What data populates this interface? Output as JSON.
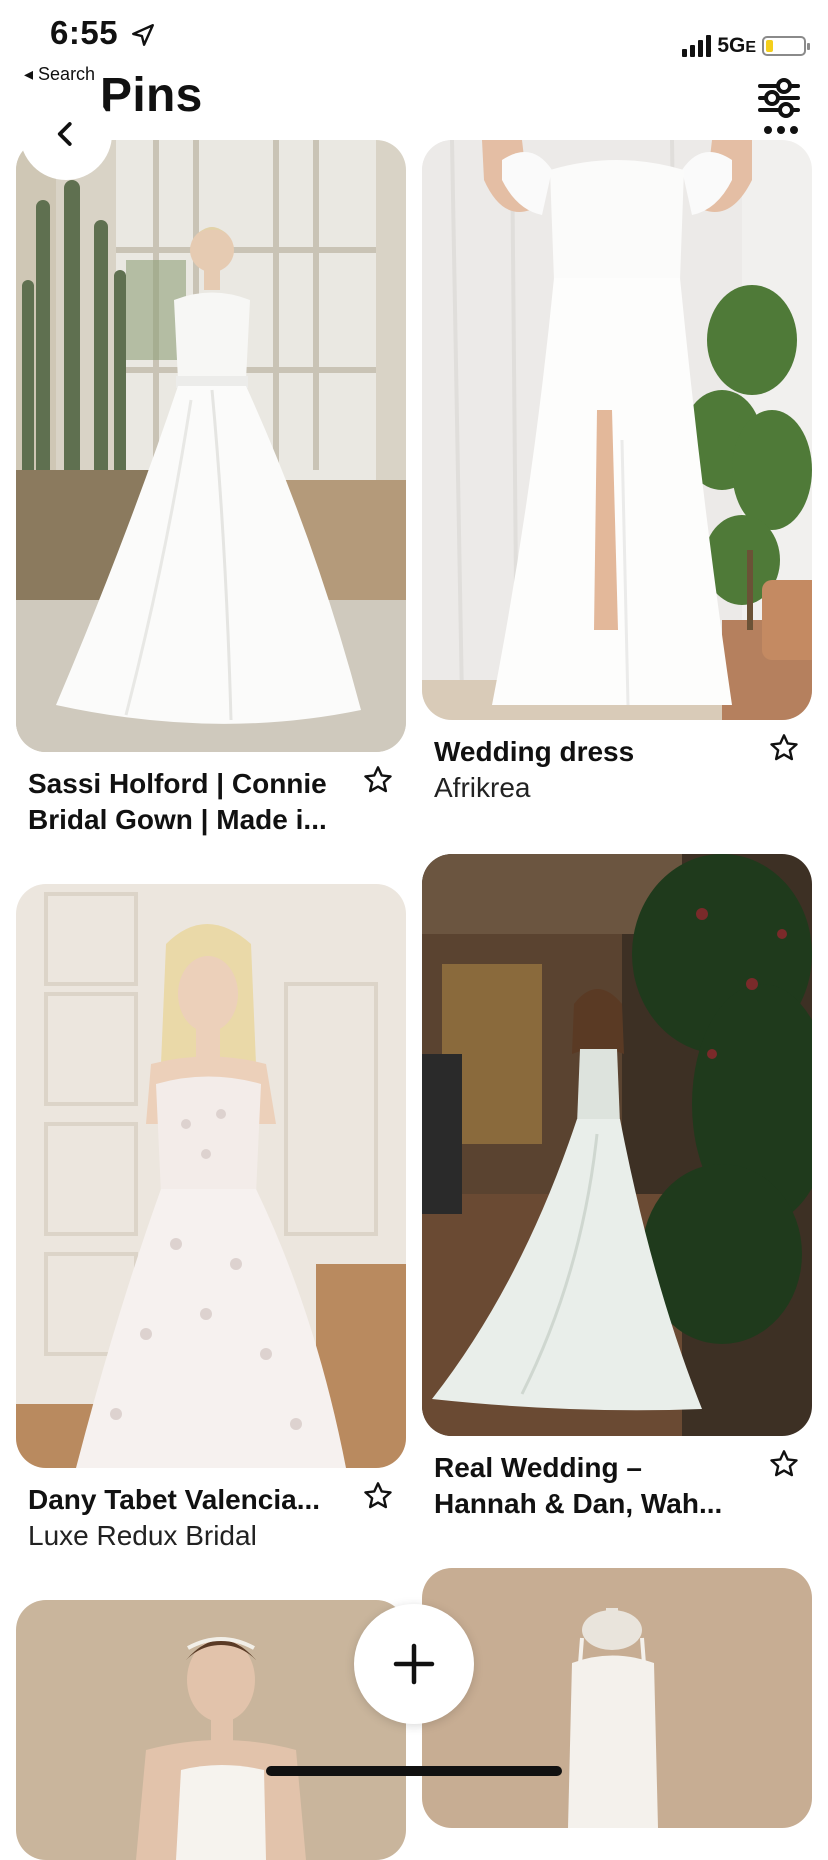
{
  "status_bar": {
    "time": "6:55",
    "network": "5G",
    "network_suffix": "E",
    "battery_level": 0.2
  },
  "nav": {
    "back_search_label": "◂ Search",
    "title": "Pins"
  },
  "pins": [
    {
      "title": "Sassi Holford | Connie Bridal Gown | Made i...",
      "subtitle": ""
    },
    {
      "title": "Wedding dress",
      "subtitle": "Afrikrea"
    },
    {
      "title": "Dany Tabet Valencia...",
      "subtitle": "Luxe Redux Bridal"
    },
    {
      "title": "Real Wedding – Hannah & Dan, Wah...",
      "subtitle": ""
    }
  ],
  "colors": {
    "accent_battery": "#f4cf1c",
    "text": "#111111",
    "background": "#ffffff"
  },
  "icons": [
    "location-arrow-icon",
    "signal-bars-icon",
    "battery-icon",
    "back-chevron-icon",
    "filter-sliders-icon",
    "more-dots-icon",
    "star-icon",
    "plus-icon"
  ]
}
